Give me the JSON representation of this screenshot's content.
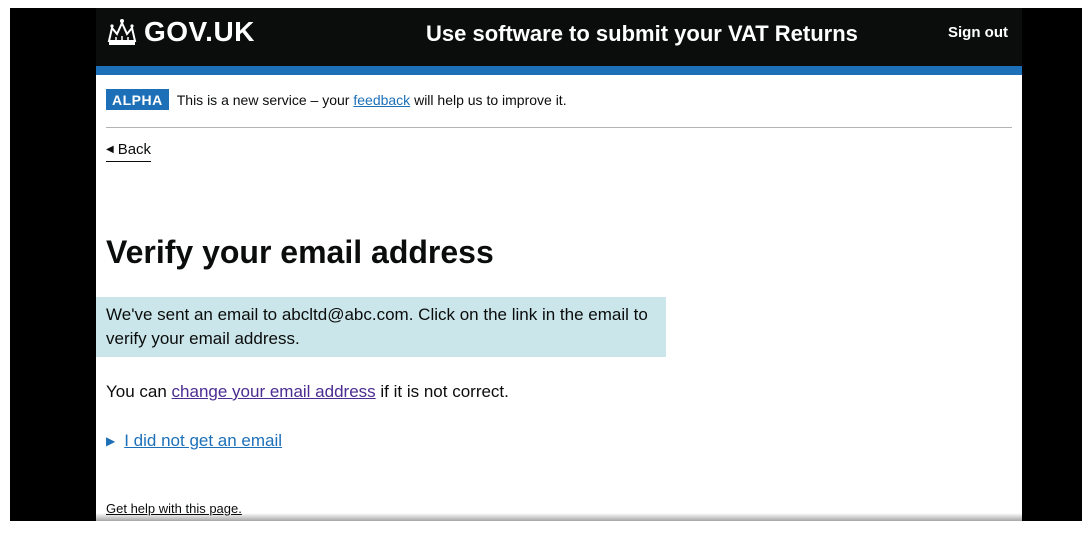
{
  "header": {
    "logo_text": "GOV.UK",
    "service_name": "Use software to submit your VAT Returns",
    "sign_out_label": "Sign out"
  },
  "phase_banner": {
    "tag": "ALPHA",
    "text_before": "This is a new service – your ",
    "link_text": "feedback",
    "text_after": " will help us to improve it."
  },
  "back_link": {
    "label": "Back"
  },
  "main": {
    "heading": "Verify your email address",
    "panel_text": "We've sent an email to abcltd@abc.com. Click on the link in the email to verify your email address.",
    "change_before": "You can ",
    "change_link": "change your email address",
    "change_after": " if it is not correct.",
    "details_summary": "I did not get an email"
  },
  "footer": {
    "help_link": "Get help with this page."
  },
  "colors": {
    "header_bg": "#0b0c0c",
    "brand_blue": "#1d70b8",
    "panel_bg": "#cbe6ea",
    "visited_link": "#4c2c92"
  },
  "icons": {
    "logo": "crown-icon",
    "back": "back-arrow-icon",
    "details": "triangle-right-icon"
  }
}
